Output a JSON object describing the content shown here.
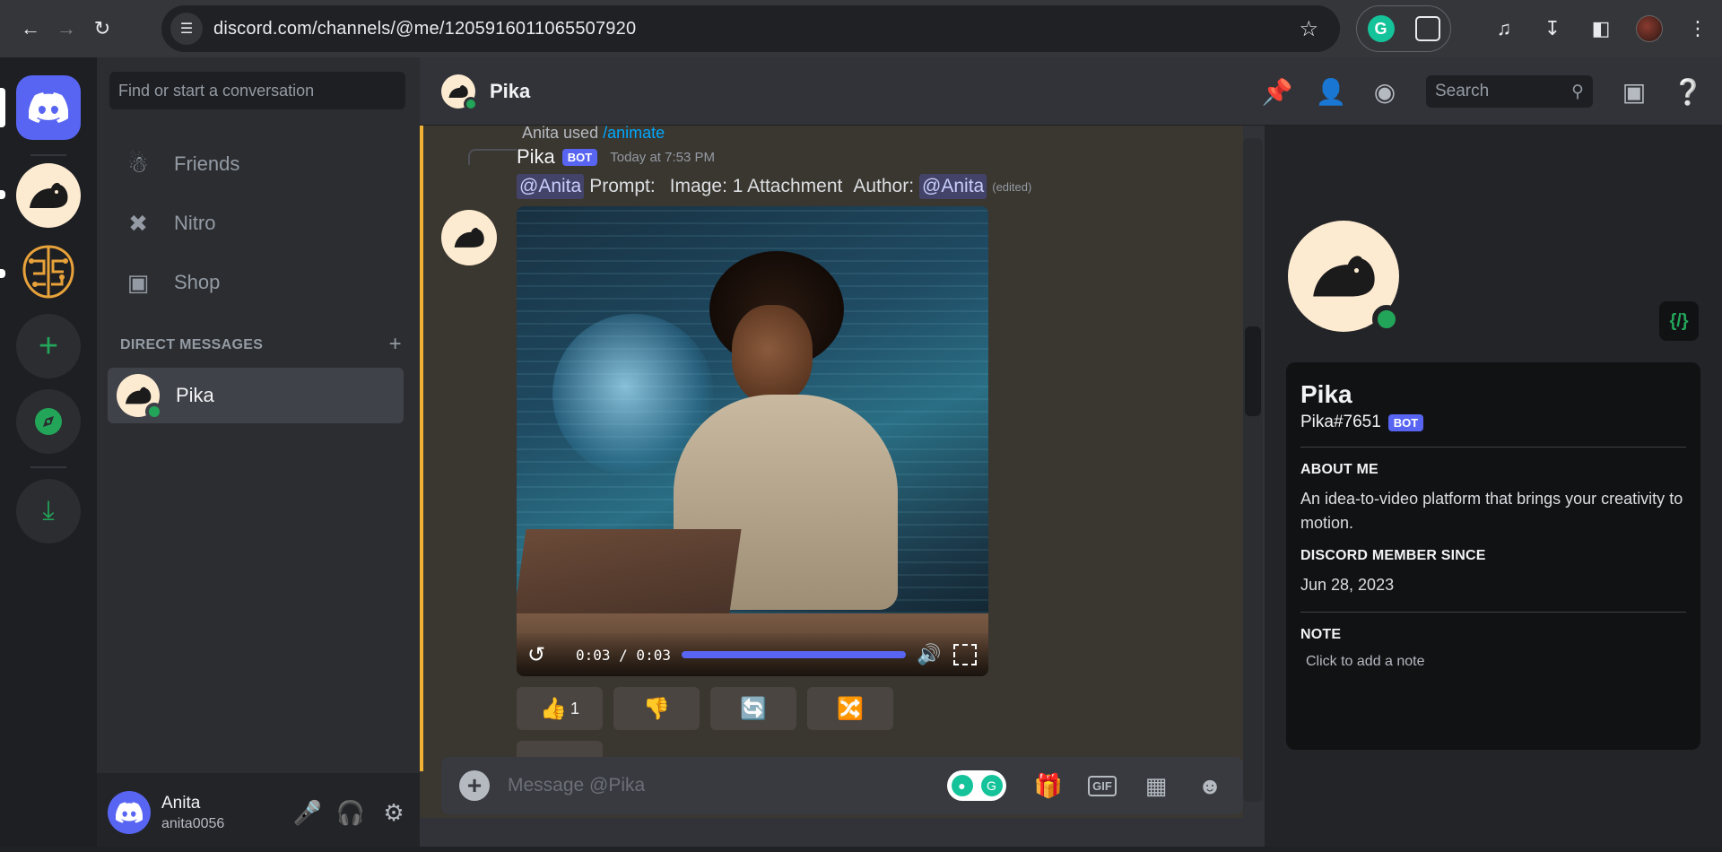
{
  "browser": {
    "url": "discord.com/channels/@me/1205916011065507920"
  },
  "dm": {
    "search_placeholder": "Find or start a conversation",
    "nav": [
      {
        "label": "Friends",
        "icon": "friends-icon"
      },
      {
        "label": "Nitro",
        "icon": "nitro-icon"
      },
      {
        "label": "Shop",
        "icon": "shop-icon"
      }
    ],
    "section_title": "DIRECT MESSAGES",
    "active": {
      "name": "Pika",
      "status": "online"
    }
  },
  "user": {
    "display_name": "Anita",
    "username": "anita0056"
  },
  "channel": {
    "title": "Pika",
    "search_placeholder": "Search"
  },
  "message": {
    "reply_user": "Anita",
    "reply_used": "used",
    "reply_command": "/animate",
    "author": "Pika",
    "bot_tag": "BOT",
    "time": "Today at 7:53 PM",
    "mention1": "@Anita",
    "prompt_text": "Prompt:",
    "image_text": "Image: 1 Attachment",
    "author_text": "Author:",
    "mention2": "@Anita",
    "edited": "(edited)",
    "video": {
      "time": "0:03 / 0:03",
      "progress": 1.0
    },
    "reactions": [
      {
        "emoji": "👍",
        "count": "1"
      },
      {
        "emoji": "👎",
        "count": ""
      },
      {
        "emoji": "🔄",
        "count": ""
      },
      {
        "emoji": "🔀",
        "count": ""
      }
    ]
  },
  "composer": {
    "placeholder": "Message @Pika",
    "gif_label": "GIF"
  },
  "profile": {
    "name": "Pika",
    "tag": "Pika#7651",
    "bot_tag": "BOT",
    "about_title": "ABOUT ME",
    "about_text": "An idea-to-video platform that brings your creativity to motion.",
    "member_title": "DISCORD MEMBER SINCE",
    "member_since": "Jun 28, 2023",
    "note_title": "NOTE",
    "note_placeholder": "Click to add a note",
    "dev_badge": "{/}"
  },
  "colors": {
    "blurple": "#5865f2",
    "online": "#23a559",
    "highlight": "#f0b232"
  }
}
